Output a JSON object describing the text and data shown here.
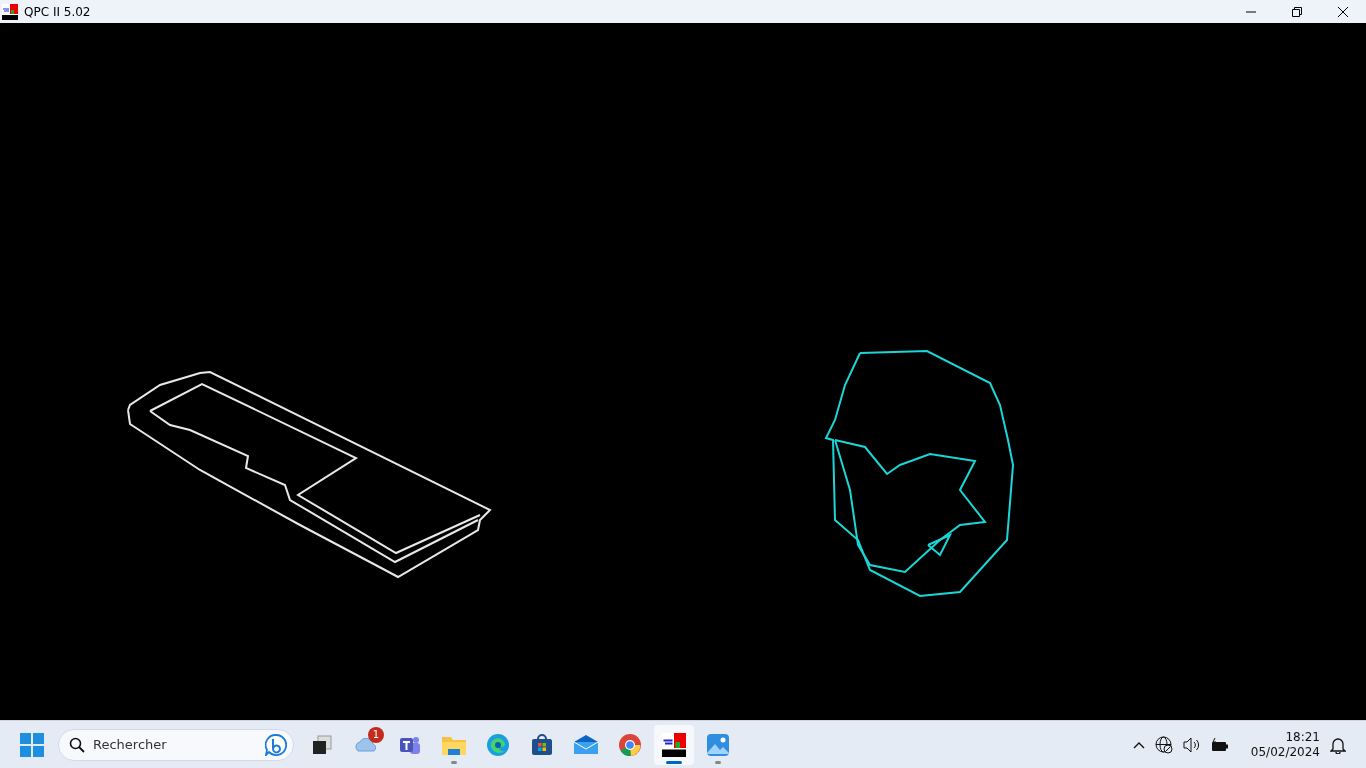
{
  "window": {
    "title": "QPC II 5.02"
  },
  "taskbar": {
    "search": {
      "placeholder": "Rechercher"
    },
    "apps": [
      {
        "kind": "taskview",
        "selected": false,
        "running": false
      },
      {
        "kind": "weather",
        "selected": false,
        "running": false,
        "badge": "1"
      },
      {
        "kind": "teams",
        "selected": false,
        "running": false
      },
      {
        "kind": "folder",
        "selected": false,
        "running": true
      },
      {
        "kind": "edge",
        "selected": false,
        "running": false
      },
      {
        "kind": "store",
        "selected": false,
        "running": false
      },
      {
        "kind": "mail",
        "selected": false,
        "running": false
      },
      {
        "kind": "chrome",
        "selected": false,
        "running": false
      },
      {
        "kind": "qpc",
        "selected": true,
        "running": true
      },
      {
        "kind": "photos",
        "selected": false,
        "running": true
      }
    ],
    "time": "18:21",
    "date": "05/02/2024"
  }
}
